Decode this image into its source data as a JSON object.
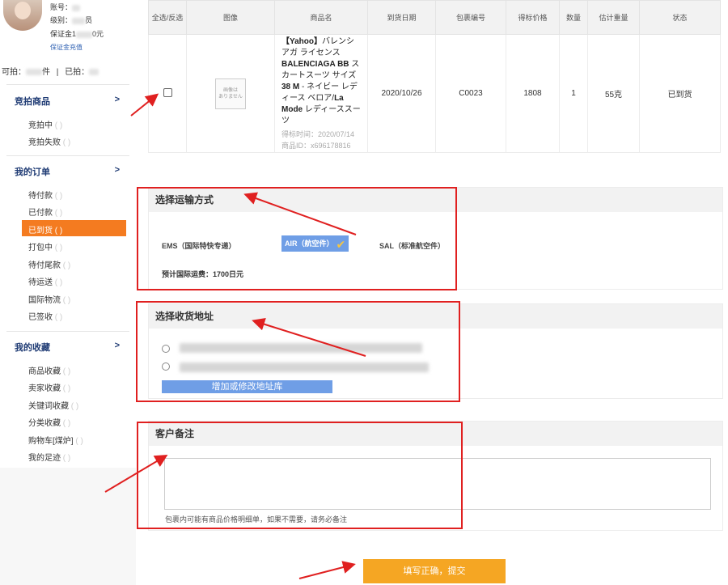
{
  "sidebar": {
    "account_label": "账号：",
    "level_label": "级别：",
    "level_suffix": "员",
    "deposit_label": "保证金1",
    "deposit_suffix": "0元",
    "deposit_link": "保证金充值",
    "can_bid_label": "可拍：",
    "can_bid_suffix": "件",
    "sep": "|",
    "bid_label": "已拍：",
    "sections": [
      {
        "title": "竞拍商品",
        "chevron": ">"
      },
      {
        "title": "我的订单",
        "chevron": ">"
      },
      {
        "title": "我的收藏",
        "chevron": ">"
      }
    ],
    "auction_items": [
      "竞拍中",
      "竞拍失败"
    ],
    "order_items": [
      "待付款",
      "已付款",
      "已到货",
      "打包中",
      "待付尾款",
      "待运送",
      "国际物流",
      "已签收"
    ],
    "fav_items": [
      "商品收藏",
      "卖家收藏",
      "关键词收藏",
      "分类收藏",
      "购物车[煤炉]",
      "我的足迹"
    ],
    "active_item": "已到货"
  },
  "table": {
    "headers": [
      "全选/反选",
      "图像",
      "商品名",
      "到货日期",
      "包裹编号",
      "得标价格",
      "数量",
      "估计重量",
      "状态"
    ],
    "row": {
      "image_text": "画像は\nありません",
      "name_prefix": "【Yahoo】",
      "name_a": "バレンシアガ ライセンス ",
      "name_b": "BALENCIAGA BB",
      "name_c": " スカートスーツ サイズ",
      "name_d": "38 M",
      "name_e": " - ネイビー レディース ベロア/",
      "name_f": "La Mode",
      "name_g": " レディーススーツ",
      "bid_time": "得标时间：2020/07/14",
      "item_id": "商品ID：x696178816",
      "arrival_date": "2020/10/26",
      "package_no": "C0023",
      "price": "1808",
      "qty": "1",
      "weight": "55克",
      "status": "已到货"
    }
  },
  "shipping": {
    "title": "选择运输方式",
    "options": [
      "EMS（国际特快专递）",
      "AIR（航空件）",
      "SAL（标准航空件）"
    ],
    "selected": "AIR（航空件）",
    "fee_label": "预计国际运费：",
    "fee_value": "1700日元"
  },
  "address": {
    "title": "选择收货地址",
    "button": "增加或修改地址库"
  },
  "remark": {
    "title": "客户备注",
    "hint": "包裹内可能有商品价格明细单，如果不需要，请务必备注"
  },
  "submit": {
    "label": "填写正确，提交"
  },
  "colors": {
    "accent": "#f47b20",
    "blue": "#6f9ee6",
    "submit": "#f5a623",
    "annotation": "#e02020",
    "nav": "#1f3b74"
  },
  "icons": {
    "check": "check-icon",
    "chevron": "chevron-right-icon"
  }
}
